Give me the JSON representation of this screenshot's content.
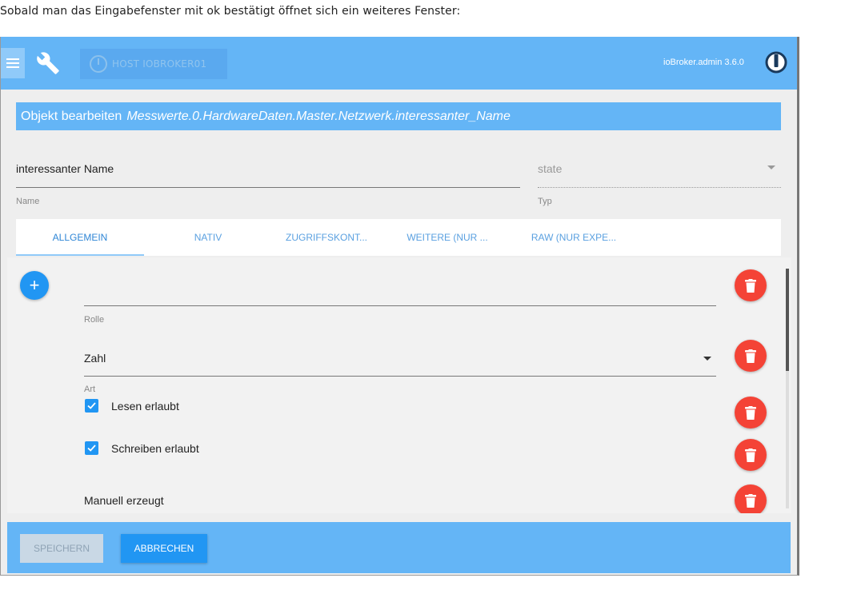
{
  "intro_text": "Sobald man das Eingabefenster mit ok bestätigt öffnet sich ein weiteres Fenster:",
  "topbar": {
    "host_label": "HOST IOBROKER01",
    "admin_version": "ioBroker.admin 3.6.0",
    "menu_icon": "hamburger-icon",
    "settings_icon": "wrench-icon",
    "host_icon": "power-icon"
  },
  "dialog": {
    "title_prefix": "Objekt bearbeiten",
    "title_path": "Messwerte.0.HardwareDaten.Master.Netzwerk.interessanter_Name",
    "name_value": "interessanter Name",
    "name_label": "Name",
    "type_value": "state",
    "type_label": "Typ"
  },
  "tabs": [
    {
      "label": "ALLGEMEIN",
      "active": true
    },
    {
      "label": "NATIV"
    },
    {
      "label": "ZUGRIFFSKONT..."
    },
    {
      "label": "WEITERE (NUR ..."
    },
    {
      "label": "RAW (NUR EXPE..."
    }
  ],
  "fields": {
    "role_value": "",
    "role_label": "Rolle",
    "type_value": "Zahl",
    "type_label": "Art",
    "read_label": "Lesen erlaubt",
    "write_label": "Schreiben erlaubt",
    "manual_label": "Manuell erzeugt",
    "add_symbol": "+"
  },
  "footer": {
    "save_label": "SPEICHERN",
    "cancel_label": "ABBRECHEN"
  },
  "colors": {
    "primary": "#64b5f6",
    "accent": "#2196f3",
    "danger": "#f44336"
  }
}
